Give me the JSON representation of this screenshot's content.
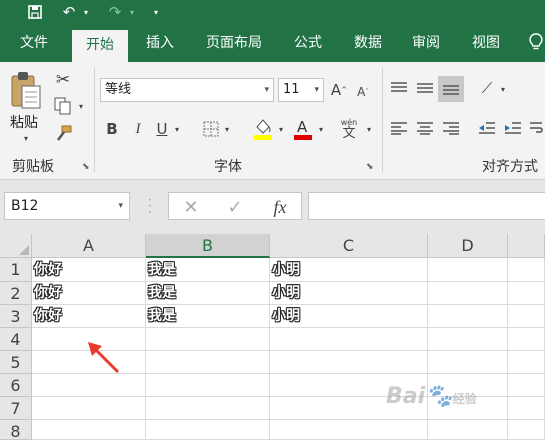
{
  "tabs": [
    "文件",
    "开始",
    "插入",
    "页面布局",
    "公式",
    "数据",
    "审阅",
    "视图"
  ],
  "active_tab": "开始",
  "ribbon": {
    "clipboard": {
      "paste_label": "粘贴",
      "group_label": "剪贴板"
    },
    "font": {
      "font_name": "等线",
      "font_size": "11",
      "group_label": "字体",
      "phonetic_label": "wén",
      "phonetic_char": "文"
    },
    "alignment": {
      "group_label": "对齐方式"
    }
  },
  "name_box": "B12",
  "formula": "",
  "formula_fx": "fx",
  "columns": [
    "A",
    "B",
    "C",
    "D"
  ],
  "selected_column": "B",
  "rows": [
    "1",
    "2",
    "3",
    "4",
    "5",
    "6",
    "7",
    "8"
  ],
  "cells": [
    [
      "你好",
      "我是",
      "小明"
    ],
    [
      "你好",
      "我是",
      "小明"
    ],
    [
      "你好",
      "我是",
      "小明"
    ]
  ],
  "colors": {
    "excel_green": "#217346",
    "font_color_bar": "#e00000",
    "highlight_bar": "#ffff00",
    "arrow": "#e8392b"
  },
  "watermark": {
    "main": "Bai",
    "suffix": "经验"
  }
}
